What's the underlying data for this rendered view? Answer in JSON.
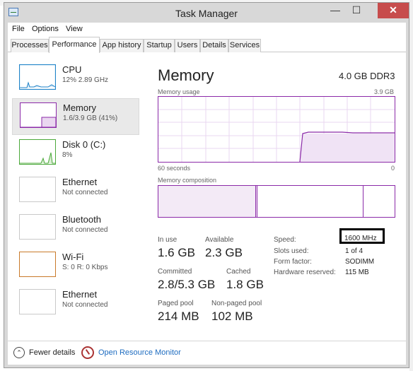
{
  "window": {
    "title": "Task Manager",
    "controls": {
      "minimize": "—",
      "maximize": "☐",
      "close": "✕"
    }
  },
  "menu": [
    "File",
    "Options",
    "View"
  ],
  "tabs": [
    {
      "label": "Processes",
      "active": false
    },
    {
      "label": "Performance",
      "active": true
    },
    {
      "label": "App history",
      "active": false
    },
    {
      "label": "Startup",
      "active": false
    },
    {
      "label": "Users",
      "active": false
    },
    {
      "label": "Details",
      "active": false
    },
    {
      "label": "Services",
      "active": false
    }
  ],
  "sidebar": [
    {
      "label": "CPU",
      "sub": "12%  2.89 GHz",
      "color": "#1f83c8",
      "active": false
    },
    {
      "label": "Memory",
      "sub": "1.6/3.9 GB (41%)",
      "color": "#8b2aa8",
      "active": true
    },
    {
      "label": "Disk 0 (C:)",
      "sub": "8%",
      "color": "#4ca93b",
      "active": false
    },
    {
      "label": "Ethernet",
      "sub": "Not connected",
      "color": "#c0c0c0",
      "active": false
    },
    {
      "label": "Bluetooth",
      "sub": "Not connected",
      "color": "#c0c0c0",
      "active": false
    },
    {
      "label": "Wi-Fi",
      "sub": "S: 0  R: 0 Kbps",
      "color": "#c97a2a",
      "active": false
    },
    {
      "label": "Ethernet",
      "sub": "Not connected",
      "color": "#c0c0c0",
      "active": false
    }
  ],
  "memory": {
    "title": "Memory",
    "type": "4.0 GB DDR3",
    "usage_label": "Memory usage",
    "usage_max": "3.9 GB",
    "time_label": "60 seconds",
    "time_end": "0",
    "composition_label": "Memory composition",
    "accent": "#8b2aa8"
  },
  "stats": {
    "in_use": {
      "label": "In use",
      "value": "1.6 GB"
    },
    "available": {
      "label": "Available",
      "value": "2.3 GB"
    },
    "committed": {
      "label": "Committed",
      "value": "2.8/5.3 GB"
    },
    "cached": {
      "label": "Cached",
      "value": "1.8 GB"
    },
    "paged_pool": {
      "label": "Paged pool",
      "value": "214 MB"
    },
    "non_paged_pool": {
      "label": "Non-paged pool",
      "value": "102 MB"
    }
  },
  "specs": [
    {
      "label": "Speed:",
      "value": "1600 MHz"
    },
    {
      "label": "Slots used:",
      "value": "1 of 4"
    },
    {
      "label": "Form factor:",
      "value": "SODIMM"
    },
    {
      "label": "Hardware reserved:",
      "value": "115 MB"
    }
  ],
  "footer": {
    "fewer_details": "Fewer details",
    "open_resource_monitor": "Open Resource Monitor"
  }
}
